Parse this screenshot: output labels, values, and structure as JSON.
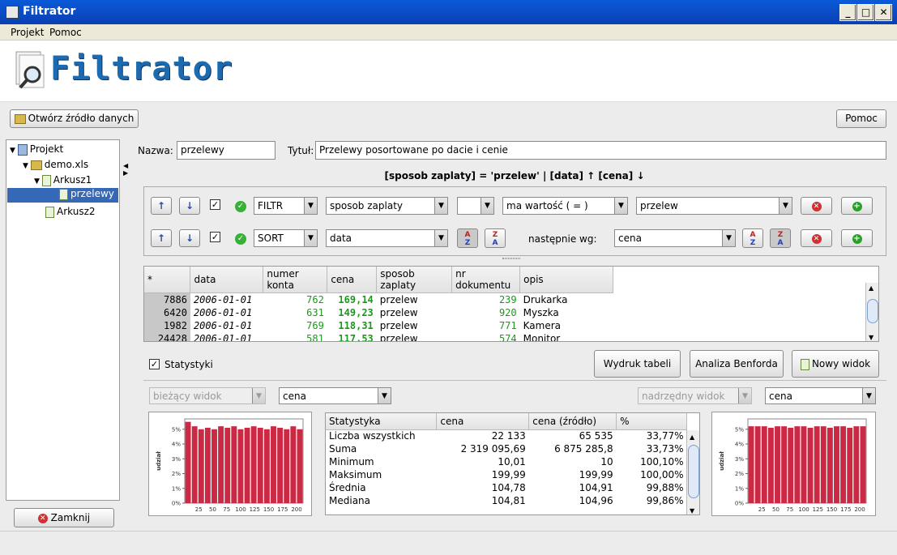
{
  "window": {
    "title": "Filtrator"
  },
  "menu": [
    "Projekt",
    "Pomoc"
  ],
  "logo": "Filtrator",
  "toolbar": {
    "open_label": "Otwórz źródło danych",
    "help_label": "Pomoc"
  },
  "tree": {
    "root": "Projekt",
    "file": "demo.xls",
    "sheet1": "Arkusz1",
    "view": "przelewy",
    "sheet2": "Arkusz2"
  },
  "close_label": "Zamknij",
  "form": {
    "name_label": "Nazwa:",
    "name_value": "przelewy",
    "title_label": "Tytuł:",
    "title_value": "Przelewy posortowane po dacie i cenie",
    "summary": "[sposob zaplaty] = 'przelew'  |  [data] ↑ [cena] ↓"
  },
  "filter_row": {
    "type": "FILTR",
    "column": "sposob zaplaty",
    "modifier": "",
    "operator": "ma wartość ( = )",
    "value": "przelew"
  },
  "sort_row": {
    "type": "SORT",
    "column": "data",
    "then_label": "następnie wg:",
    "then_column": "cena"
  },
  "table": {
    "headers": [
      "*",
      "data",
      "numer konta",
      "cena",
      "sposob zaplaty",
      "nr dokumentu",
      "opis"
    ],
    "rows": [
      [
        "7886",
        "2006-01-01",
        "762",
        "169,14",
        "przelew",
        "239",
        "Drukarka"
      ],
      [
        "6420",
        "2006-01-01",
        "631",
        "149,23",
        "przelew",
        "920",
        "Myszka"
      ],
      [
        "1982",
        "2006-01-01",
        "769",
        "118,31",
        "przelew",
        "771",
        "Kamera"
      ],
      [
        "24428",
        "2006-01-01",
        "581",
        "117,53",
        "przelew",
        "574",
        "Monitor"
      ]
    ]
  },
  "stats": {
    "checkbox_label": "Statystyki",
    "print_label": "Wydruk tabeli",
    "benford_label": "Analiza Benforda",
    "new_view_label": "Nowy widok",
    "current_view": "bieżący widok",
    "left_column": "cena",
    "parent_view": "nadrzędny widok",
    "right_column": "cena",
    "headers": [
      "Statystyka",
      "cena",
      "cena (źródło)",
      "%"
    ],
    "rows": [
      [
        "Liczba wszystkich",
        "22 133",
        "65 535",
        "33,77%"
      ],
      [
        "Suma",
        "2 319 095,69",
        "6 875 285,8",
        "33,73%"
      ],
      [
        "Minimum",
        "10,01",
        "10",
        "100,10%"
      ],
      [
        "Maksimum",
        "199,99",
        "199,99",
        "100,00%"
      ],
      [
        "Średnia",
        "104,78",
        "104,91",
        "99,88%"
      ],
      [
        "Mediana",
        "104,81",
        "104,96",
        "99,86%"
      ]
    ]
  },
  "chart_data": [
    {
      "type": "bar",
      "ylabel": "udział",
      "xticks": [
        "25",
        "50",
        "75",
        "100",
        "125",
        "150",
        "175",
        "200"
      ],
      "yticks": [
        "0%",
        "1%",
        "2%",
        "3%",
        "4%",
        "5%"
      ],
      "ylim": [
        0,
        5.7
      ],
      "values": [
        5.5,
        5.2,
        5.0,
        5.1,
        5.0,
        5.2,
        5.1,
        5.2,
        5.0,
        5.1,
        5.2,
        5.1,
        5.0,
        5.2,
        5.1,
        5.0,
        5.2,
        5.0
      ],
      "color": "#cc2a44"
    },
    {
      "type": "bar",
      "ylabel": "udział",
      "xticks": [
        "25",
        "50",
        "75",
        "100",
        "125",
        "150",
        "175",
        "200"
      ],
      "yticks": [
        "0%",
        "1%",
        "2%",
        "3%",
        "4%",
        "5%"
      ],
      "ylim": [
        0,
        5.7
      ],
      "values": [
        5.2,
        5.2,
        5.2,
        5.1,
        5.2,
        5.2,
        5.1,
        5.2,
        5.2,
        5.1,
        5.2,
        5.2,
        5.1,
        5.2,
        5.2,
        5.1,
        5.2,
        5.2
      ],
      "color": "#cc2a44"
    }
  ]
}
